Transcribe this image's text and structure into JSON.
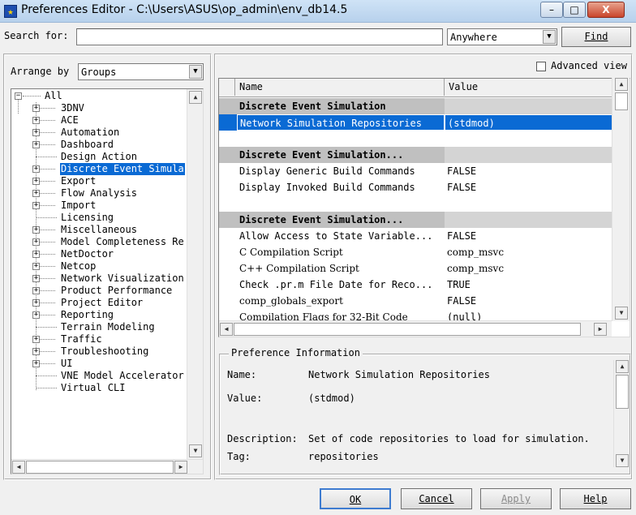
{
  "window": {
    "title": "Preferences Editor - C:\\Users\\ASUS\\op_admin\\env_db14.5",
    "minimize": "–",
    "maximize": "□",
    "close": "X"
  },
  "search": {
    "label": "Search for:",
    "value": "",
    "scope": "Anywhere",
    "find_label": "Find"
  },
  "arrange": {
    "label": "Arrange by",
    "value": "Groups"
  },
  "tree": {
    "root": "All",
    "items": [
      {
        "label": "3DNV",
        "expandable": true
      },
      {
        "label": "ACE",
        "expandable": true
      },
      {
        "label": "Automation",
        "expandable": true
      },
      {
        "label": "Dashboard",
        "expandable": true
      },
      {
        "label": "Design Action",
        "expandable": false
      },
      {
        "label": "Discrete Event Simula",
        "expandable": true,
        "selected": true
      },
      {
        "label": "Export",
        "expandable": true
      },
      {
        "label": "Flow Analysis",
        "expandable": true
      },
      {
        "label": "Import",
        "expandable": true
      },
      {
        "label": "Licensing",
        "expandable": false
      },
      {
        "label": "Miscellaneous",
        "expandable": true
      },
      {
        "label": "Model Completeness Re",
        "expandable": true
      },
      {
        "label": "NetDoctor",
        "expandable": true
      },
      {
        "label": "Netcop",
        "expandable": true
      },
      {
        "label": "Network Visualization",
        "expandable": true
      },
      {
        "label": "Product Performance",
        "expandable": true
      },
      {
        "label": "Project Editor",
        "expandable": true
      },
      {
        "label": "Reporting",
        "expandable": true
      },
      {
        "label": "Terrain Modeling",
        "expandable": false
      },
      {
        "label": "Traffic",
        "expandable": true
      },
      {
        "label": "Troubleshooting",
        "expandable": true
      },
      {
        "label": "UI",
        "expandable": true
      },
      {
        "label": "VNE Model Accelerator",
        "expandable": false
      },
      {
        "label": "Virtual CLI",
        "expandable": false
      }
    ]
  },
  "advanced": {
    "label": "Advanced view",
    "checked": false
  },
  "grid": {
    "columns": [
      "Name",
      "Value"
    ],
    "rows": [
      {
        "type": "header",
        "name": "Discrete Event Simulation",
        "value": ""
      },
      {
        "type": "item",
        "name": "Network Simulation Repositories",
        "value": "(stdmod)",
        "selected": true
      },
      {
        "type": "blank",
        "name": "",
        "value": ""
      },
      {
        "type": "header",
        "name": "Discrete Event Simulation...",
        "value": ""
      },
      {
        "type": "item",
        "name": "Display Generic Build Commands",
        "value": "FALSE"
      },
      {
        "type": "item",
        "name": "Display Invoked Build Commands",
        "value": "FALSE"
      },
      {
        "type": "blank",
        "name": "",
        "value": ""
      },
      {
        "type": "header",
        "name": "Discrete Event Simulation...",
        "value": ""
      },
      {
        "type": "item",
        "name": "Allow Access to State Variable...",
        "value": "FALSE"
      },
      {
        "type": "item",
        "name": "C Compilation Script",
        "value": "comp_msvc"
      },
      {
        "type": "item",
        "name": "C++ Compilation Script",
        "value": "comp_msvc"
      },
      {
        "type": "item",
        "name": "Check .pr.m File Date for Reco...",
        "value": "TRUE"
      },
      {
        "type": "item",
        "name": "comp_globals_export",
        "value": "FALSE"
      },
      {
        "type": "item",
        "name": "Compilation Flags for 32-Bit Code",
        "value": "(null)"
      }
    ]
  },
  "info": {
    "title": "Preference Information",
    "name_label": "Name:",
    "name": "Network Simulation Repositories",
    "value_label": "Value:",
    "value": "(stdmod)",
    "description_label": "Description:",
    "description": "Set of code repositories to load for simulation.",
    "tag_label": "Tag:",
    "tag": "repositories"
  },
  "buttons": {
    "ok": "OK",
    "cancel": "Cancel",
    "apply": "Apply",
    "help": "Help"
  }
}
